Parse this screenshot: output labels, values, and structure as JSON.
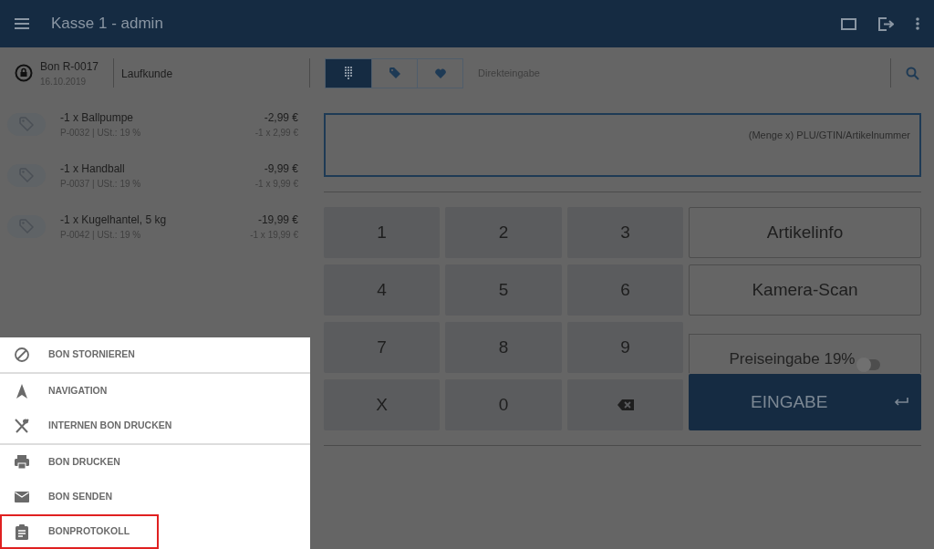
{
  "app_bar": {
    "title": "Kasse 1 - admin"
  },
  "receipt": {
    "number": "Bon R-0017",
    "date": "16.10.2019",
    "customer": "Laufkunde"
  },
  "input_tabs": [
    {
      "kind": "keypad",
      "selected": true
    },
    {
      "kind": "tag",
      "selected": false
    },
    {
      "kind": "heart",
      "selected": false
    }
  ],
  "input_mode": "Direkteingabe",
  "items": [
    {
      "name": "-1 x Ballpumpe",
      "details": "P-0032 | USt.: 19 %",
      "total": "-2,99 €",
      "calc": "-1 x 2,99 €"
    },
    {
      "name": "-1 x Handball",
      "details": "P-0037 | USt.: 19 %",
      "total": "-9,99 €",
      "calc": "-1 x 9,99 €"
    },
    {
      "name": "-1 x Kugelhantel, 5 kg",
      "details": "P-0042 | USt.: 19 %",
      "total": "-19,99 €",
      "calc": "-1 x 19,99 €"
    }
  ],
  "entry_field": {
    "placeholder": "(Menge x) PLU/GTIN/Artikelnummer"
  },
  "keys": [
    {
      "kind": "digit",
      "label": "1"
    },
    {
      "kind": "digit",
      "label": "2"
    },
    {
      "kind": "digit",
      "label": "3"
    },
    {
      "kind": "digit",
      "label": "4"
    },
    {
      "kind": "digit",
      "label": "5"
    },
    {
      "kind": "digit",
      "label": "6"
    },
    {
      "kind": "digit",
      "label": "7"
    },
    {
      "kind": "digit",
      "label": "8"
    },
    {
      "kind": "digit",
      "label": "9"
    },
    {
      "kind": "digit",
      "label": "X"
    },
    {
      "kind": "digit",
      "label": "0"
    },
    {
      "kind": "backspace"
    }
  ],
  "side_buttons": [
    "Artikelinfo",
    "Kamera-Scan"
  ],
  "price_toggle": {
    "label": "Preiseingabe 19%",
    "on": false
  },
  "enter_button": "EINGABE",
  "menu": {
    "groups": [
      {
        "items": [
          {
            "kind": "cancel",
            "label": "BON STORNIEREN",
            "highlighted": false
          }
        ]
      },
      {
        "items": [
          {
            "kind": "navigation",
            "label": "NAVIGATION",
            "highlighted": false
          },
          {
            "kind": "internal",
            "label": "INTERNEN BON DRUCKEN",
            "highlighted": false
          }
        ]
      },
      {
        "items": [
          {
            "kind": "print",
            "label": "BON DRUCKEN",
            "highlighted": false
          },
          {
            "kind": "send",
            "label": "BON SENDEN",
            "highlighted": false
          },
          {
            "kind": "log",
            "label": "BONPROTOKOLL",
            "highlighted": true
          }
        ]
      }
    ]
  }
}
